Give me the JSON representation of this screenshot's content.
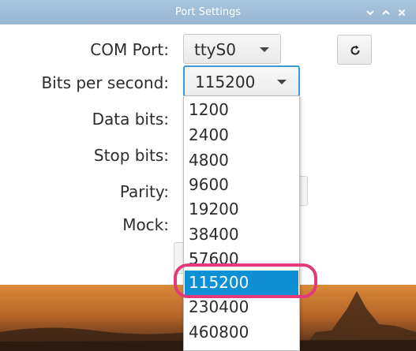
{
  "window": {
    "title": "Port Settings",
    "controls": [
      "minimize",
      "maximize",
      "close"
    ]
  },
  "form": {
    "com_port": {
      "label": "COM Port:",
      "value": "ttyS0"
    },
    "bits_per_second": {
      "label": "Bits per second:",
      "value": "115200"
    },
    "data_bits": {
      "label": "Data bits:"
    },
    "stop_bits": {
      "label": "Stop bits:"
    },
    "parity": {
      "label": "Parity:"
    },
    "mock": {
      "label": "Mock:"
    },
    "refresh_icon": "refresh-icon"
  },
  "dropdown": {
    "options": [
      "1200",
      "2400",
      "4800",
      "9600",
      "19200",
      "38400",
      "57600",
      "115200",
      "230400",
      "460800"
    ],
    "selected": "115200"
  },
  "colors": {
    "title_bar": "#9fbdd8",
    "selection": "#0f8fd4",
    "focus_border": "#3a9bd6",
    "annotation": "#e23a7a"
  }
}
